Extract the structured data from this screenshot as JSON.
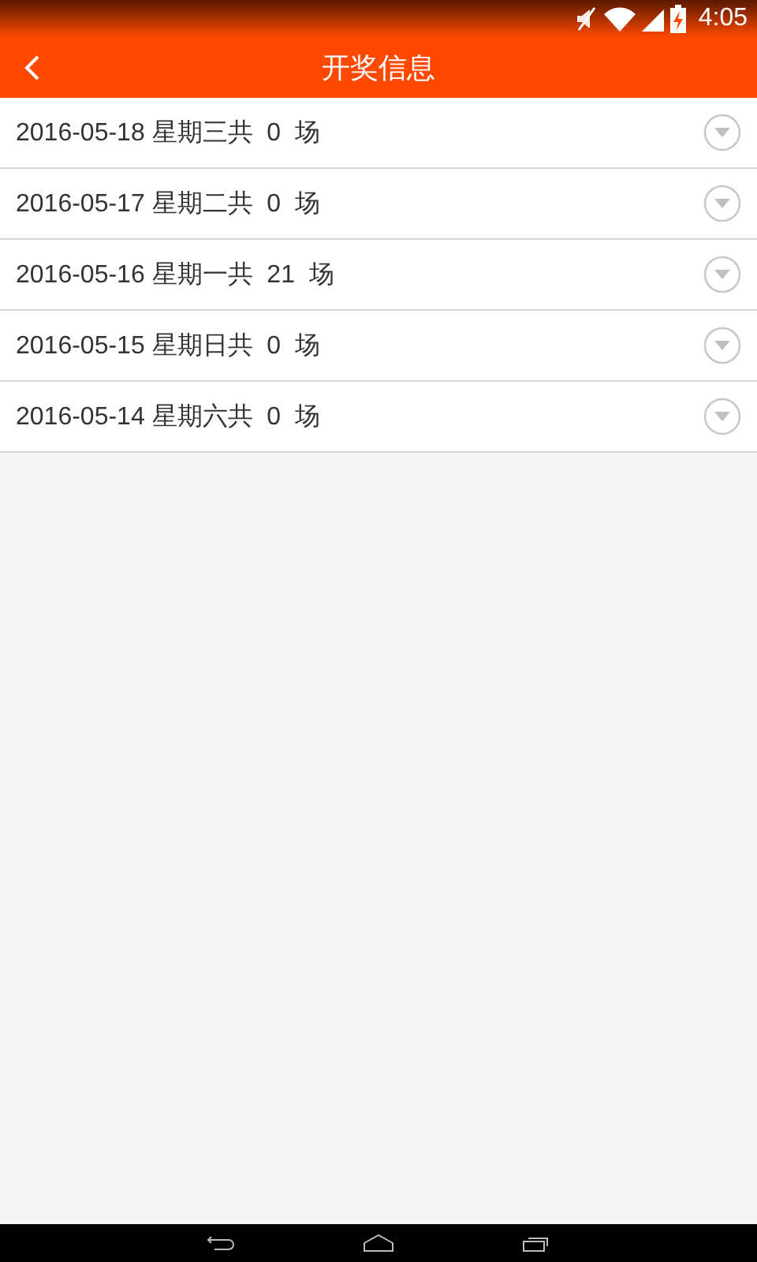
{
  "status_bar": {
    "time": "4:05"
  },
  "app_bar": {
    "title": "开奖信息"
  },
  "rows": [
    {
      "text": "2016-05-18 星期三共  0  场"
    },
    {
      "text": "2016-05-17 星期二共  0  场"
    },
    {
      "text": "2016-05-16 星期一共  21  场"
    },
    {
      "text": "2016-05-15 星期日共  0  场"
    },
    {
      "text": "2016-05-14 星期六共  0  场"
    }
  ]
}
